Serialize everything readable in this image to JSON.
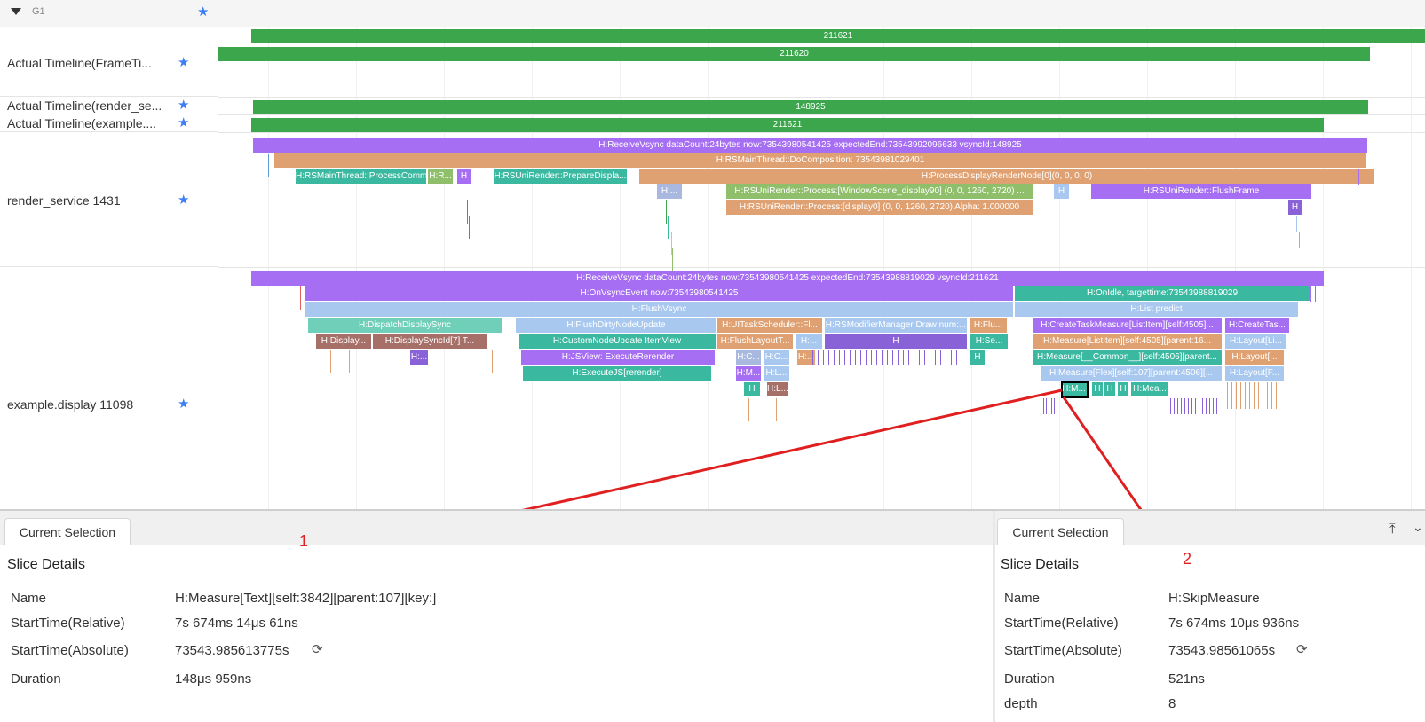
{
  "group": {
    "name": "G1",
    "star_icon": "star-icon"
  },
  "rows": [
    {
      "label": "Actual Timeline(FrameTi..."
    },
    {
      "label": "Actual Timeline(render_se..."
    },
    {
      "label": "Actual Timeline(example...."
    },
    {
      "label": "render_service 1431"
    },
    {
      "label": "example.display 11098"
    }
  ],
  "slices": [
    {
      "label": "211621",
      "color": "#3ba64c"
    },
    {
      "label": "211620",
      "color": "#3ba64c"
    },
    {
      "label": "148925",
      "color": "#3ba64c"
    },
    {
      "label": "211621",
      "color": "#3ba64c"
    },
    {
      "label": "H:ReceiveVsync dataCount:24bytes now:73543980541425 expectedEnd:73543992096633 vsyncId:148925",
      "color": "#a66ef2"
    },
    {
      "label": "H:RSMainThread::DoComposition: 73543981029401",
      "color": "#e0a172"
    },
    {
      "label": "H:RSMainThread::ProcessComm...",
      "color": "#3bb9a0"
    },
    {
      "label": "H:R...",
      "color": "#8fbf6a"
    },
    {
      "label": "H",
      "color": "#a66ef2"
    },
    {
      "label": "H:RSUniRender::PrepareDispla...",
      "color": "#3bb9a0"
    },
    {
      "label": "H:ProcessDisplayRenderNode[0](0, 0, 0, 0)",
      "color": "#e0a172"
    },
    {
      "label": "H:...",
      "color": "#a8b8de"
    },
    {
      "label": "H:RSUniRender::Process:[WindowScene_display90] (0, 0, 1260, 2720) ...",
      "color": "#8fbf6a"
    },
    {
      "label": "H:RSUniRender::Process:[display0] (0, 0, 1260, 2720) Alpha: 1.000000",
      "color": "#e0a172"
    },
    {
      "label": "H",
      "color": "#a8c8f0"
    },
    {
      "label": "H:RSUniRender::FlushFrame",
      "color": "#a66ef2"
    },
    {
      "label": "H",
      "color": "#8a62d8"
    },
    {
      "label": "H:ReceiveVsync dataCount:24bytes now:73543980541425 expectedEnd:73543988819029 vsyncId:211621",
      "color": "#a66ef2"
    },
    {
      "label": "H:OnVsyncEvent now:73543980541425",
      "color": "#a66ef2"
    },
    {
      "label": "H:OnIdle, targettime:73543988819029",
      "color": "#3bb9a0"
    },
    {
      "label": "H:FlushVsync",
      "color": "#a8c8f0"
    },
    {
      "label": "H:List predict",
      "color": "#a8c8f0"
    },
    {
      "label": "H:DispatchDisplaySync",
      "color": "#6fcfb8"
    },
    {
      "label": "H:FlushDirtyNodeUpdate",
      "color": "#a8c8f0"
    },
    {
      "label": "H:UITaskScheduler::Fl...",
      "color": "#e0a172"
    },
    {
      "label": "H:RSModifierManager Draw num:...",
      "color": "#a8c8f0"
    },
    {
      "label": "H:Flu...",
      "color": "#e0a172"
    },
    {
      "label": "H:CreateTaskMeasure[ListItem][self:4505]...",
      "color": "#a66ef2"
    },
    {
      "label": "H:CreateTas...",
      "color": "#a66ef2"
    },
    {
      "label": "H:Display...",
      "color": "#a67068"
    },
    {
      "label": "H:DisplaySyncId[7] T...",
      "color": "#a67068"
    },
    {
      "label": "H:CustomNodeUpdate ItemView",
      "color": "#3bb9a0"
    },
    {
      "label": "H:FlushLayoutT...",
      "color": "#e0a172"
    },
    {
      "label": "H:...",
      "color": "#a8c8f0"
    },
    {
      "label": "H",
      "color": "#8a62d8"
    },
    {
      "label": "H:Se...",
      "color": "#3bb9a0"
    },
    {
      "label": "H:Measure[ListItem][self:4505][parent:16...",
      "color": "#e0a172"
    },
    {
      "label": "H:Layout[Li...",
      "color": "#a8c8f0"
    },
    {
      "label": "H:...",
      "color": "#8a62d8"
    },
    {
      "label": "H:JSView: ExecuteRerender",
      "color": "#a66ef2"
    },
    {
      "label": "H:C...",
      "color": "#a8b8de"
    },
    {
      "label": "H:C...",
      "color": "#a8c8f0"
    },
    {
      "label": "H:...",
      "color": "#e0a172"
    },
    {
      "label": "H",
      "color": "#3bb9a0"
    },
    {
      "label": "H:Measure[__Common__][self:4506][parent...",
      "color": "#3bb9a0"
    },
    {
      "label": "H:Layout[...",
      "color": "#e0a172"
    },
    {
      "label": "H:ExecuteJS[rerender]",
      "color": "#3bb9a0"
    },
    {
      "label": "H:M...",
      "color": "#a66ef2"
    },
    {
      "label": "H:L...",
      "color": "#a8c8f0"
    },
    {
      "label": "H:Measure[Flex][self:107][parent:4506][...",
      "color": "#a8c8f0"
    },
    {
      "label": "H:Layout[F...",
      "color": "#a8c8f0"
    },
    {
      "label": "H",
      "color": "#3bb9a0"
    },
    {
      "label": "H:L...",
      "color": "#a67068"
    },
    {
      "label": "H:M...",
      "color": "#3bb9a0"
    },
    {
      "label": "H",
      "color": "#3bb9a0"
    },
    {
      "label": "H",
      "color": "#3bb9a0"
    },
    {
      "label": "H",
      "color": "#3bb9a0"
    },
    {
      "label": "H:Mea...",
      "color": "#3bb9a0"
    }
  ],
  "panels": [
    {
      "tab": "Current Selection",
      "title": "Slice Details",
      "details": [
        {
          "label": "Name",
          "value": "H:Measure[Text][self:3842][parent:107][key:]"
        },
        {
          "label": "StartTime(Relative)",
          "value": "7s 674ms 14μs 61ns"
        },
        {
          "label": "StartTime(Absolute)",
          "value": "73543.985613775s",
          "icon": "refresh-icon"
        },
        {
          "label": "Duration",
          "value": "148μs 959ns"
        }
      ],
      "annotation": "1"
    },
    {
      "tab": "Current Selection",
      "title": "Slice Details",
      "details": [
        {
          "label": "Name",
          "value": "H:SkipMeasure"
        },
        {
          "label": "StartTime(Relative)",
          "value": "7s 674ms 10μs 936ns"
        },
        {
          "label": "StartTime(Absolute)",
          "value": "73543.98561065s",
          "icon": "refresh-icon"
        },
        {
          "label": "Duration",
          "value": "521ns"
        },
        {
          "label": "depth",
          "value": "8"
        }
      ],
      "annotation": "2"
    }
  ],
  "colors": {
    "accent": "#3d7ef5",
    "annotation": "#e02020",
    "green": "#3ba64c",
    "purple": "#a66ef2"
  }
}
